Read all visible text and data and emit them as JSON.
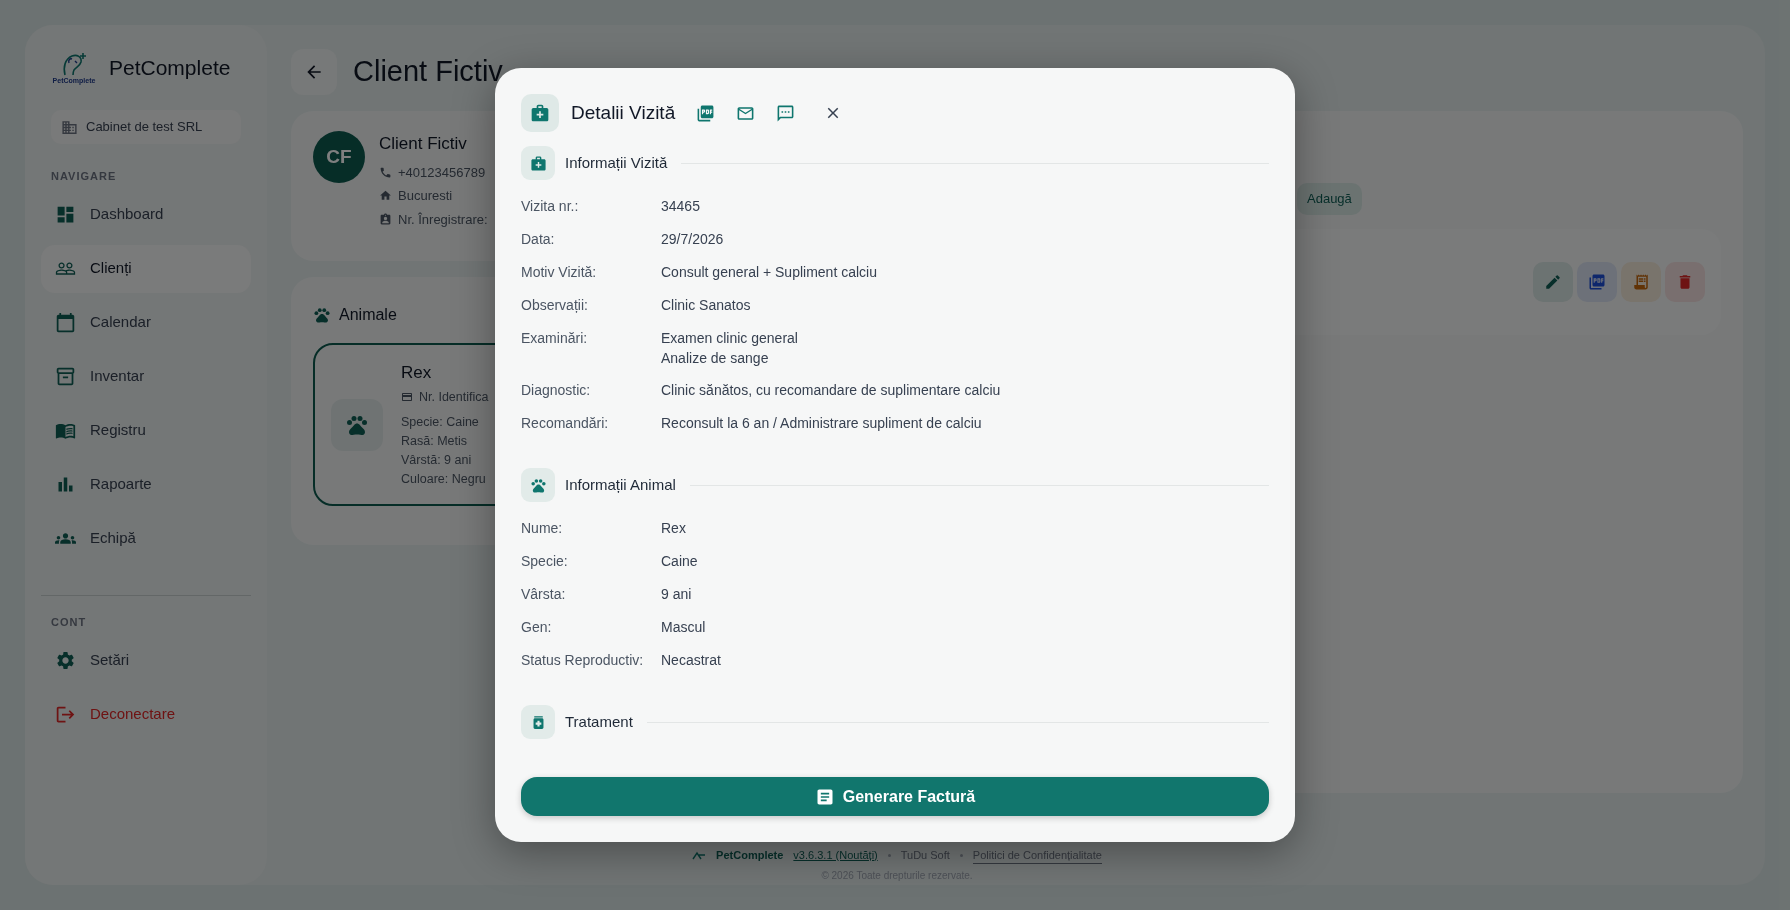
{
  "sidebar": {
    "brand": "PetComplete",
    "logo_text": "PetComplete",
    "clinic": "Cabinet de test SRL",
    "sections": [
      {
        "title": "NAVIGARE",
        "items": [
          {
            "label": "Dashboard",
            "selected": false,
            "kind": "normal"
          },
          {
            "label": "Clienți",
            "selected": true,
            "kind": "normal"
          },
          {
            "label": "Calendar",
            "selected": false,
            "kind": "normal"
          },
          {
            "label": "Inventar",
            "selected": false,
            "kind": "normal"
          },
          {
            "label": "Registru",
            "selected": false,
            "kind": "normal"
          },
          {
            "label": "Rapoarte",
            "selected": false,
            "kind": "normal"
          },
          {
            "label": "Echipă",
            "selected": false,
            "kind": "normal"
          }
        ]
      },
      {
        "title": "CONT",
        "items": [
          {
            "label": "Setări",
            "selected": false,
            "kind": "normal"
          },
          {
            "label": "Deconectare",
            "selected": false,
            "kind": "danger"
          }
        ]
      }
    ]
  },
  "page": {
    "title": "Client Fictiv"
  },
  "client": {
    "initials": "CF",
    "name": "Client Fictiv",
    "phone": "+40123456789",
    "city": "Bucuresti",
    "registration": "Nr. Înregistrare:"
  },
  "animals": {
    "title": "Animale",
    "cards": [
      {
        "name": "Rex",
        "id_label": "Nr. Identifica",
        "details": [
          "Specie: Caine",
          "Rasă: Metis",
          "Vârstă: 9 ani",
          "Culoare: Negru"
        ],
        "selected": true
      }
    ]
  },
  "visits_panel": {
    "add_button": "Adaugă"
  },
  "modal": {
    "title": "Detalii Vizită",
    "button": "Generare Factură",
    "sections": [
      {
        "title": "Informații Vizită",
        "rows": [
          {
            "label": "Vizita nr.:",
            "lines": [
              "34465"
            ]
          },
          {
            "label": "Data:",
            "lines": [
              "29/7/2026"
            ]
          },
          {
            "label": "Motiv Vizită:",
            "lines": [
              "Consult general + Supliment calciu"
            ]
          },
          {
            "label": "Observații:",
            "lines": [
              "Clinic Sanatos"
            ]
          },
          {
            "label": "Examinări:",
            "lines": [
              "Examen clinic general",
              "Analize de sange"
            ]
          },
          {
            "label": "Diagnostic:",
            "lines": [
              "Clinic sănătos, cu recomandare de suplimentare calciu"
            ]
          },
          {
            "label": "Recomandări:",
            "lines": [
              "Reconsult la 6 an / Administrare supliment de calciu"
            ]
          }
        ]
      },
      {
        "title": "Informații Animal",
        "rows": [
          {
            "label": "Nume:",
            "lines": [
              "Rex"
            ]
          },
          {
            "label": "Specie:",
            "lines": [
              "Caine"
            ]
          },
          {
            "label": "Vârsta:",
            "lines": [
              "9 ani"
            ]
          },
          {
            "label": "Gen:",
            "lines": [
              "Mascul"
            ]
          },
          {
            "label": "Status Reproductiv:",
            "lines": [
              "Necastrat"
            ]
          }
        ]
      },
      {
        "title": "Tratament"
      }
    ]
  },
  "footer": {
    "brand": "PetComplete",
    "version": "v3.6.3.1 (Noutăți)",
    "company": "TuDu Soft",
    "privacy": "Politici de Confidențialitate",
    "copyright": "© 2026 Toate drepturile rezervate."
  }
}
